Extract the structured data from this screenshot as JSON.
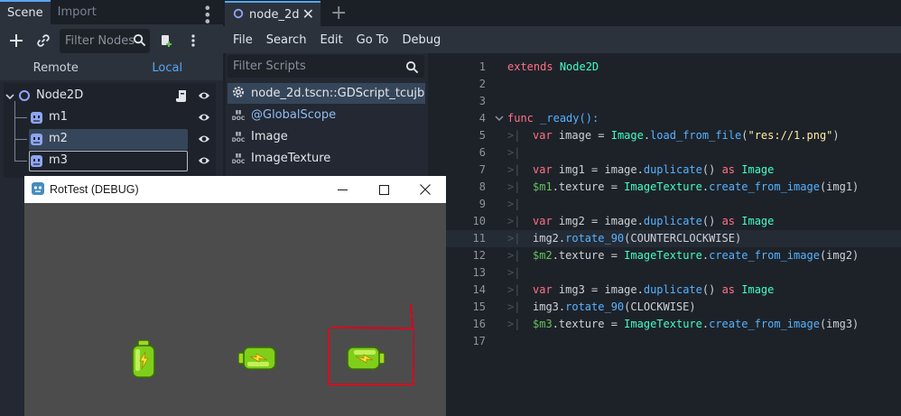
{
  "scene_dock": {
    "tabs": [
      "Scene",
      "Import"
    ],
    "filter_placeholder": "Filter Nodes",
    "remote_label": "Remote",
    "local_label": "Local",
    "nodes": [
      {
        "name": "Node2D",
        "icon": "node2d-icon"
      },
      {
        "name": "m1",
        "icon": "sprite-icon"
      },
      {
        "name": "m2",
        "icon": "sprite-icon"
      },
      {
        "name": "m3",
        "icon": "sprite-icon"
      }
    ]
  },
  "editor": {
    "tab_label": "node_2d",
    "menu": [
      "File",
      "Search",
      "Edit",
      "Go To",
      "Debug"
    ],
    "filter_scripts_placeholder": "Filter Scripts",
    "scripts": [
      "node_2d.tscn::GDScript_tcujb",
      "@GlobalScope",
      "Image",
      "ImageTexture"
    ],
    "lines": [
      "1",
      "2",
      "3",
      "4",
      "5",
      "6",
      "7",
      "8",
      "9",
      "10",
      "11",
      "12",
      "13",
      "14",
      "15",
      "16",
      "17"
    ],
    "code": {
      "l1_kw": "extends",
      "l1_ty": "Node2D",
      "l4_kw": "func",
      "l4_rest": "_ready():",
      "l5_var": "var",
      "l5_a": "image = ",
      "l5_ty": "Image",
      "l5_b": ".",
      "l5_fn": "load_from_file",
      "l5_c": "(",
      "l5_st": "\"res://1.png\"",
      "l5_d": ")",
      "l7_var": "var",
      "l7_a": "img1 = image.",
      "l7_fn": "duplicate",
      "l7_b": "() ",
      "l7_as": "as",
      "l7_ty": "Image",
      "l8_nd": "$m1",
      "l8_a": ".texture = ",
      "l8_ty": "ImageTexture",
      "l8_b": ".",
      "l8_fn": "create_from_image",
      "l8_c": "(img1)",
      "l10_var": "var",
      "l10_a": "img2 = image.",
      "l10_fn": "duplicate",
      "l10_b": "() ",
      "l10_as": "as",
      "l10_ty": "Image",
      "l11_a": "img2.",
      "l11_fn": "rotate_90",
      "l11_b": "(COUNTERCLOCKWISE)",
      "l12_nd": "$m2",
      "l12_a": ".texture = ",
      "l12_ty": "ImageTexture",
      "l12_b": ".",
      "l12_fn": "create_from_image",
      "l12_c": "(img2)",
      "l14_var": "var",
      "l14_a": "img3 = image.",
      "l14_fn": "duplicate",
      "l14_b": "() ",
      "l14_as": "as",
      "l14_ty": "Image",
      "l15_a": "img3.",
      "l15_fn": "rotate_90",
      "l15_b": "(CLOCKWISE)",
      "l16_nd": "$m3",
      "l16_a": ".texture = ",
      "l16_ty": "ImageTexture",
      "l16_b": ".",
      "l16_fn": "create_from_image",
      "l16_c": "(img3)"
    }
  },
  "debug_window": {
    "title": "RotTest (DEBUG)"
  },
  "colors": {
    "accent": "#56a6f2",
    "keyword": "#ff7085",
    "type": "#42ffc2",
    "function": "#57b3ff",
    "string": "#ffeda1",
    "node_path": "#63c259",
    "annotation": "#e0001b"
  }
}
